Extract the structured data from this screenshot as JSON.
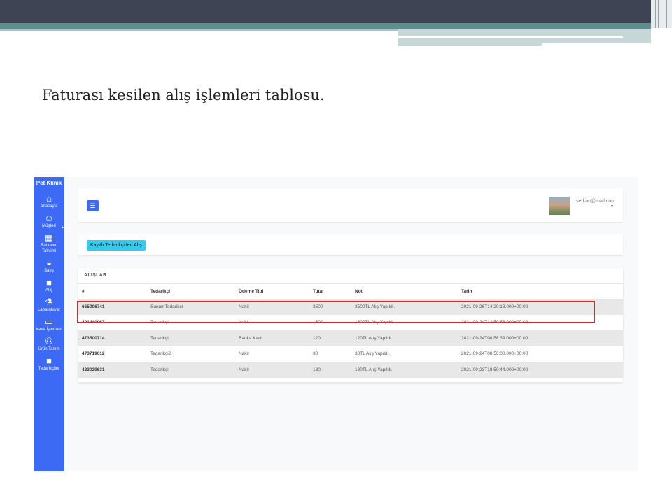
{
  "slide_title": "Faturası kesilen alış işlemleri tablosu.",
  "app": {
    "brand": "Pet Klinik",
    "sidebar": [
      {
        "icon": "home-icon",
        "glyph": "⌂",
        "label": "Anasayfa"
      },
      {
        "icon": "user-icon",
        "glyph": "☺",
        "label": "Müşteri"
      },
      {
        "icon": "calendar-icon",
        "glyph": "▦",
        "label": "Randevu Takvimi"
      },
      {
        "icon": "basket-icon",
        "glyph": "◒",
        "label": "Satış"
      },
      {
        "icon": "truck-icon",
        "glyph": "■",
        "label": "Alış"
      },
      {
        "icon": "flask-icon",
        "glyph": "⚗",
        "label": "Labaratuvar"
      },
      {
        "icon": "cash-icon",
        "glyph": "▭",
        "label": "Kasa İşlemleri"
      },
      {
        "icon": "people-icon",
        "glyph": "⚇",
        "label": "Ürün Tanım"
      },
      {
        "icon": "truck-icon",
        "glyph": "■",
        "label": "Tedarikçiler"
      }
    ],
    "user": {
      "email": "serkan@mail.com"
    },
    "action_button": "Kayıtlı Tedarikçiden Alış",
    "card_title": "ALIŞLAR",
    "table": {
      "headers": [
        "#",
        "Tedarikçi",
        "Ödeme Tipi",
        "Tutar",
        "Not",
        "Tarih"
      ],
      "rows": [
        [
          "665906741",
          "SunumTedarikci",
          "Nakit",
          "3500",
          "3500TL Alış Yapıldı.",
          "2021-09-26T14:20:18.000+00:00"
        ],
        [
          "491440067",
          "Tedarikçi",
          "Nakit",
          "1800",
          "1800TL Alış Yapıldı.",
          "2021-09-24T13:50:58.000+00:00"
        ],
        [
          "473500714",
          "Tedarikçi",
          "Banka Kartı",
          "120",
          "120TL Alış Yapıldı.",
          "2021-09-24T08:58:39.000+00:00"
        ],
        [
          "473719612",
          "Tedarikçi2",
          "Nakit",
          "30",
          "30TL Alış Yapıldı.",
          "2021-09-24T08:56:00.000+00:00"
        ],
        [
          "423029631",
          "Tedarikçi",
          "Nakit",
          "180",
          "180TL Alış Yapıldı.",
          "2021-09-23T18:50:44.000+00:00"
        ]
      ],
      "highlighted_row": 0
    },
    "colors": {
      "sidebar": "#3d6af5",
      "action_button": "#33ccf0",
      "highlight": "#d9252a"
    }
  }
}
